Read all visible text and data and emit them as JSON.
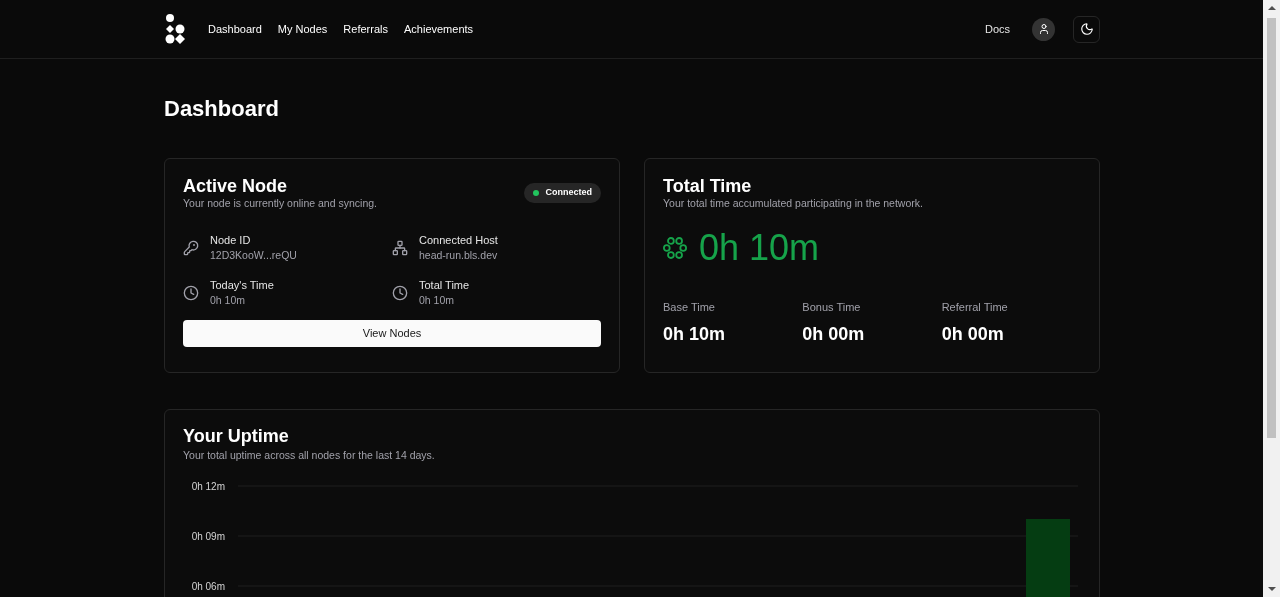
{
  "nav": {
    "links": [
      "Dashboard",
      "My Nodes",
      "Referrals",
      "Achievements"
    ],
    "docs": "Docs"
  },
  "page_title": "Dashboard",
  "active_node": {
    "title": "Active Node",
    "subtitle": "Your node is currently online and syncing.",
    "status": {
      "label": "Connected",
      "color": "#22c55e"
    },
    "fields": [
      {
        "kind": "key",
        "label": "Node ID",
        "value": "12D3KooW...reQU"
      },
      {
        "kind": "host",
        "label": "Connected Host",
        "value": "head-run.bls.dev"
      },
      {
        "kind": "clock",
        "label": "Today's Time",
        "value": "0h 10m"
      },
      {
        "kind": "clock",
        "label": "Total Time",
        "value": "0h 10m"
      }
    ],
    "button": "View Nodes"
  },
  "total_time": {
    "title": "Total Time",
    "subtitle": "Your total time accumulated participating in the network.",
    "value": "0h 10m",
    "breakdown": [
      {
        "label": "Base Time",
        "value": "0h 10m"
      },
      {
        "label": "Bonus Time",
        "value": "0h 00m"
      },
      {
        "label": "Referral Time",
        "value": "0h 00m"
      }
    ]
  },
  "uptime": {
    "title": "Your Uptime",
    "subtitle": "Your total uptime across all nodes for the last 14 days.",
    "y_axis_labels": [
      "0h 12m",
      "0h 09m",
      "0h 06m"
    ]
  }
}
